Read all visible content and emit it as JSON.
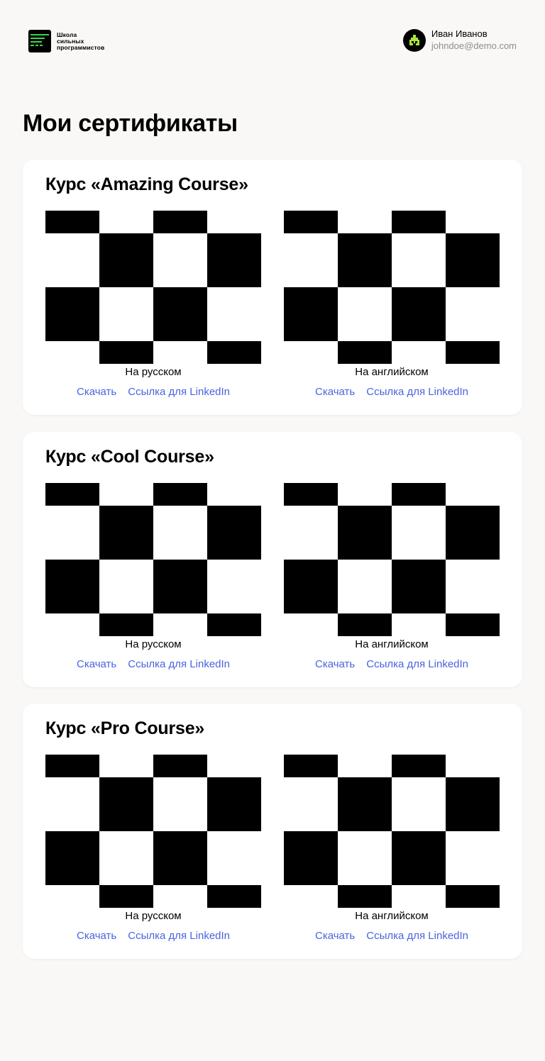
{
  "header": {
    "logo_lines": [
      "Школа",
      "сильных",
      "программистов"
    ],
    "user": {
      "name": "Иван Иванов",
      "email": "johndoe@demo.com"
    }
  },
  "page": {
    "title": "Мои сертификаты"
  },
  "courses": [
    {
      "title": "Курс «Amazing Course»",
      "certificates": [
        {
          "caption": "На русском",
          "download_label": "Скачать",
          "linkedin_label": "Ссылка для LinkedIn"
        },
        {
          "caption": "На английском",
          "download_label": "Скачать",
          "linkedin_label": "Ссылка для LinkedIn"
        }
      ]
    },
    {
      "title": "Курс «Cool Course»",
      "certificates": [
        {
          "caption": "На русском",
          "download_label": "Скачать",
          "linkedin_label": "Ссылка для LinkedIn"
        },
        {
          "caption": "На английском",
          "download_label": "Скачать",
          "linkedin_label": "Ссылка для LinkedIn"
        }
      ]
    },
    {
      "title": "Курс «Pro Course»",
      "certificates": [
        {
          "caption": "На русском",
          "download_label": "Скачать",
          "linkedin_label": "Ссылка для LinkedIn"
        },
        {
          "caption": "На английском",
          "download_label": "Скачать",
          "linkedin_label": "Ссылка для LinkedIn"
        }
      ]
    }
  ],
  "colors": {
    "background": "#f9f8f6",
    "card": "#ffffff",
    "link": "#4b63e0",
    "muted": "#8d8d8d",
    "accent_green": "#3fd24c"
  },
  "icons": {
    "logo": "school-logo-icon",
    "avatar": "pixel-avatar-icon",
    "certificate_preview": "checkerboard-placeholder-image"
  }
}
